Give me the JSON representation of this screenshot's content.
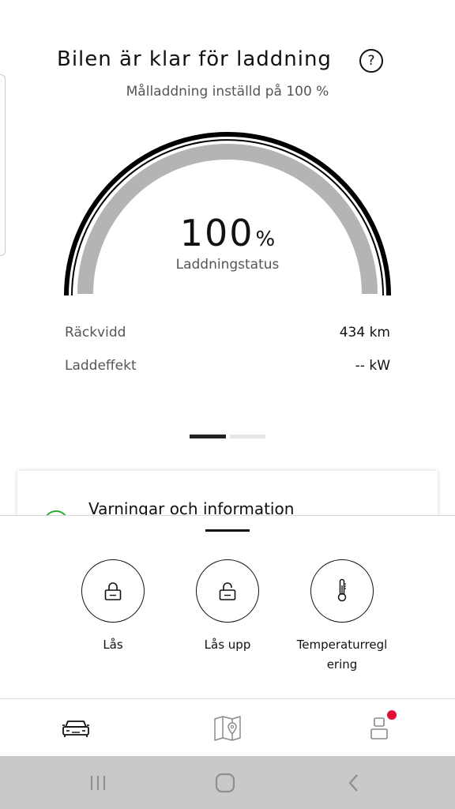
{
  "header": {
    "title": "Bilen är klar för laddning",
    "help_icon": "help-icon",
    "help_label": "?",
    "subtitle": "Målladdning inställd på 100 %"
  },
  "gauge": {
    "charge_level": 100,
    "value": "100",
    "unit": "%",
    "label": "Laddningstatus",
    "fill_color": "#b4b4b4",
    "outline_color": "#000000"
  },
  "stats": [
    {
      "label": "Räckvidd",
      "value": "434 km"
    },
    {
      "label": "Laddeffekt",
      "value": "-- kW"
    }
  ],
  "pager": {
    "pages": 2,
    "active": 0
  },
  "card": {
    "title": "Varningar och information",
    "status_color": "#2faa3c"
  },
  "actions": [
    {
      "label": "Lås",
      "icon": "lock-icon"
    },
    {
      "label": "Lås upp",
      "icon": "unlock-icon"
    },
    {
      "label": "Temperaturreglering",
      "icon": "thermometer-icon"
    }
  ],
  "tabbar": {
    "tabs": [
      {
        "icon": "car-icon",
        "active": true
      },
      {
        "icon": "map-icon",
        "active": false
      },
      {
        "icon": "user-icon",
        "active": false
      }
    ],
    "badge_color": "#e0103a"
  },
  "system_nav": {
    "buttons": [
      "recent-apps-icon",
      "home-icon",
      "back-icon"
    ]
  }
}
